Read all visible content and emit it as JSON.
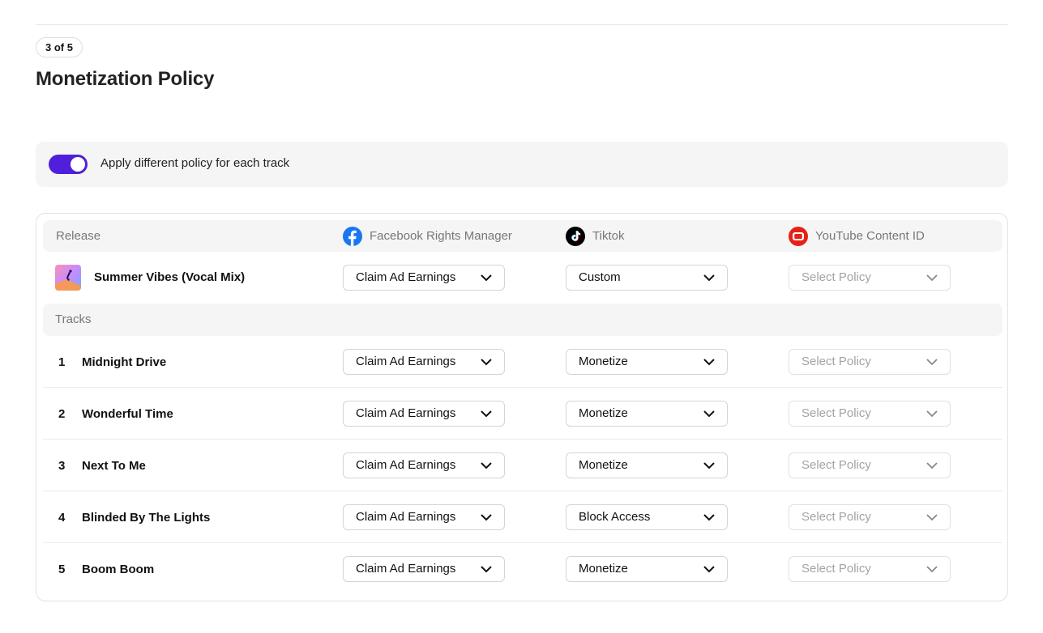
{
  "step": "3 of 5",
  "page_title": "Monetization Policy",
  "toggle": {
    "label": "Apply different policy for each track",
    "enabled": true,
    "color": "#4f1fdc"
  },
  "table": {
    "headers": {
      "release": "Release",
      "facebook": "Facebook Rights Manager",
      "tiktok": "Tiktok",
      "youtube": "YouTube Content ID"
    },
    "icons": {
      "facebook": "facebook-icon",
      "tiktok": "tiktok-icon",
      "youtube": "youtube-icon"
    },
    "release": {
      "title": "Summer Vibes (Vocal Mix)",
      "facebook": "Claim Ad Earnings",
      "tiktok": "Custom",
      "youtube": "Select Policy"
    },
    "tracks_label": "Tracks",
    "tracks": [
      {
        "num": "1",
        "title": "Midnight Drive",
        "facebook": "Claim Ad Earnings",
        "tiktok": "Monetize",
        "youtube": "Select Policy"
      },
      {
        "num": "2",
        "title": "Wonderful Time",
        "facebook": "Claim Ad Earnings",
        "tiktok": "Monetize",
        "youtube": "Select Policy"
      },
      {
        "num": "3",
        "title": "Next To Me",
        "facebook": "Claim Ad Earnings",
        "tiktok": "Monetize",
        "youtube": "Select Policy"
      },
      {
        "num": "4",
        "title": "Blinded By The Lights",
        "facebook": "Claim Ad Earnings",
        "tiktok": "Block Access",
        "youtube": "Select Policy"
      },
      {
        "num": "5",
        "title": "Boom Boom",
        "facebook": "Claim Ad Earnings",
        "tiktok": "Monetize",
        "youtube": "Select Policy"
      }
    ]
  }
}
